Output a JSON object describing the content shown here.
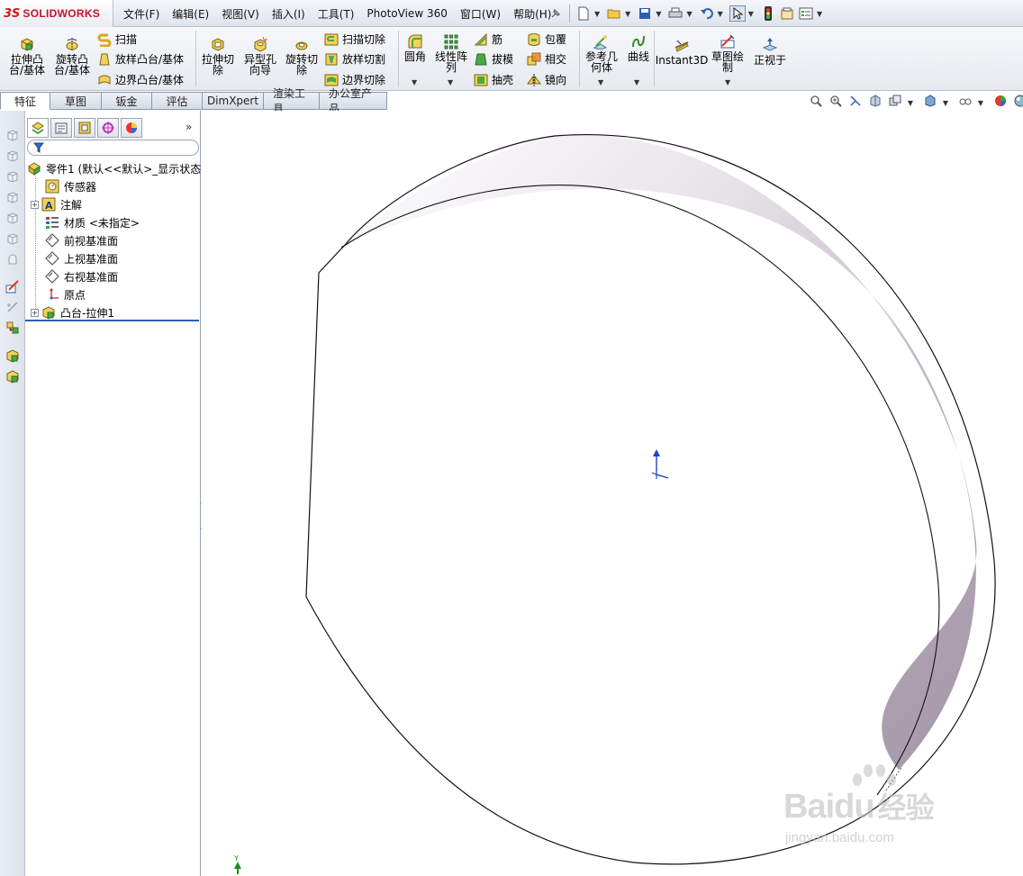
{
  "app": {
    "logo_mark": "3S",
    "logo_text": "SOLIDWORKS"
  },
  "menu": [
    "文件(F)",
    "编辑(E)",
    "视图(V)",
    "插入(I)",
    "工具(T)",
    "PhotoView 360",
    "窗口(W)",
    "帮助(H)"
  ],
  "features": {
    "extrude_boss": [
      "拉伸凸",
      "台/基体"
    ],
    "revolve_boss": [
      "旋转凸",
      "台/基体"
    ],
    "sweep": "扫描",
    "loft": "放样凸台/基体",
    "boundary_boss": "边界凸台/基体",
    "extrude_cut": [
      "拉伸切",
      "除"
    ],
    "hole_wizard": [
      "异型孔",
      "向导"
    ],
    "revolve_cut": [
      "旋转切",
      "除"
    ],
    "swept_cut": "扫描切除",
    "lofted_cut": "放样切割",
    "boundary_cut": "边界切除",
    "fillet": "圆角",
    "linear_pattern": [
      "线性阵",
      "列"
    ],
    "rib": "筋",
    "draft": "拔模",
    "shell": "抽壳",
    "wrap": "包覆",
    "intersect": "相交",
    "mirror": "镜向",
    "ref_geometry": [
      "参考几",
      "何体"
    ],
    "curves": "曲线",
    "instant3d": "Instant3D",
    "sketch": [
      "草图绘",
      "制"
    ],
    "normal_to": "正视于"
  },
  "tabs": [
    "特征",
    "草图",
    "钣金",
    "评估",
    "DimXpert",
    "渲染工具",
    "办公室产品"
  ],
  "tree": {
    "root": "零件1 (默认<<默认>_显示状态",
    "items": [
      "传感器",
      "注解",
      "材质 <未指定>",
      "前视基准面",
      "上视基准面",
      "右视基准面",
      "原点",
      "凸台-拉伸1"
    ]
  },
  "viewport": {
    "triad_label": "Y"
  },
  "watermark": {
    "brand": "Bai",
    "brand2": "du",
    "brand_cn": "经验",
    "url": "jingyan.baidu.com"
  },
  "colors": {
    "accent": "#2b5fb4",
    "logo": "#c8102e",
    "shading_dark": "#a597a8"
  }
}
